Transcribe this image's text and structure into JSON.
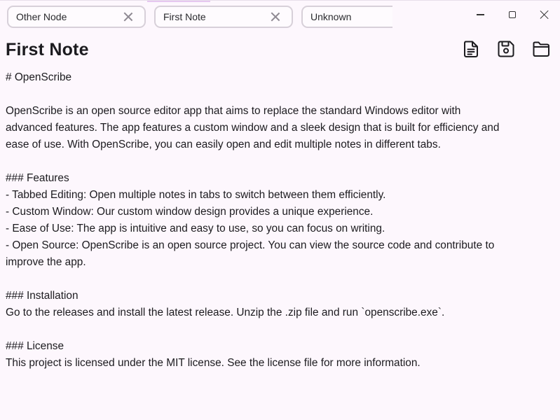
{
  "tabs": [
    {
      "label": "Other Node"
    },
    {
      "label": "First Note"
    },
    {
      "label": "Unknown"
    }
  ],
  "window_controls": {
    "minimize_icon": "minimize-icon",
    "maximize_icon": "maximize-icon",
    "close_icon": "close-icon"
  },
  "note": {
    "title": "First Note"
  },
  "toolbar": {
    "new_icon": "new-document-icon",
    "save_icon": "save-icon",
    "open_icon": "folder-icon"
  },
  "content": {
    "lines": [
      "# OpenScribe",
      "",
      "OpenScribe is an open source editor app that aims to replace the standard Windows editor with",
      "advanced features. The app features a custom window and a sleek design that is built for efficiency and",
      "ease of use. With OpenScribe, you can easily open and edit multiple notes in different tabs.",
      "",
      "### Features",
      "- Tabbed Editing: Open multiple notes in tabs to switch between them efficiently.",
      "- Custom Window: Our custom window design provides a unique experience.",
      "- Ease of Use: The app is intuitive and easy to use, so you can focus on writing.",
      "- Open Source: OpenScribe is an open source project. You can view the source code and contribute to",
      "improve the app.",
      "",
      "### Installation",
      "Go to the releases and install the latest release. Unzip the .zip file and run `openscribe.exe`.",
      "",
      "### License",
      "This project is licensed under the MIT license. See the license file for more information."
    ]
  }
}
